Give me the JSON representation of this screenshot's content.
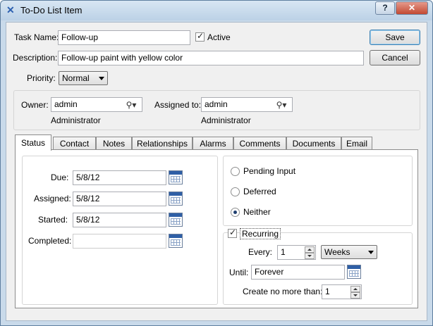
{
  "window": {
    "title": "To-Do List Item",
    "help_label": "?",
    "close_label": "✕"
  },
  "header": {
    "task_name_label": "Task Name:",
    "task_name_value": "Follow-up",
    "active_label": "Active",
    "active_checked": true,
    "description_label": "Description:",
    "description_value": "Follow-up paint with yellow color",
    "priority_label": "Priority:",
    "priority_value": "Normal"
  },
  "buttons": {
    "save": "Save",
    "cancel": "Cancel"
  },
  "assignment": {
    "owner_label": "Owner:",
    "owner_value": "admin",
    "owner_name": "Administrator",
    "assigned_to_label": "Assigned to:",
    "assigned_to_value": "admin",
    "assigned_to_name": "Administrator"
  },
  "tabs": [
    {
      "label": "Status",
      "active": true
    },
    {
      "label": "Contact"
    },
    {
      "label": "Notes"
    },
    {
      "label": "Relationships"
    },
    {
      "label": "Alarms"
    },
    {
      "label": "Comments"
    },
    {
      "label": "Documents"
    },
    {
      "label": "Email"
    }
  ],
  "status": {
    "due_label": "Due:",
    "due_value": "5/8/12",
    "assigned_label": "Assigned:",
    "assigned_value": "5/8/12",
    "started_label": "Started:",
    "started_value": "5/8/12",
    "completed_label": "Completed:",
    "completed_value": "",
    "options": [
      "Pending Input",
      "Deferred",
      "Neither"
    ],
    "selected_option": "Neither"
  },
  "recurring": {
    "label": "Recurring",
    "checked": true,
    "every_label": "Every:",
    "every_value": "1",
    "period_value": "Weeks",
    "until_label": "Until:",
    "until_value": "Forever",
    "max_label": "Create no more than:",
    "max_value": "1"
  }
}
